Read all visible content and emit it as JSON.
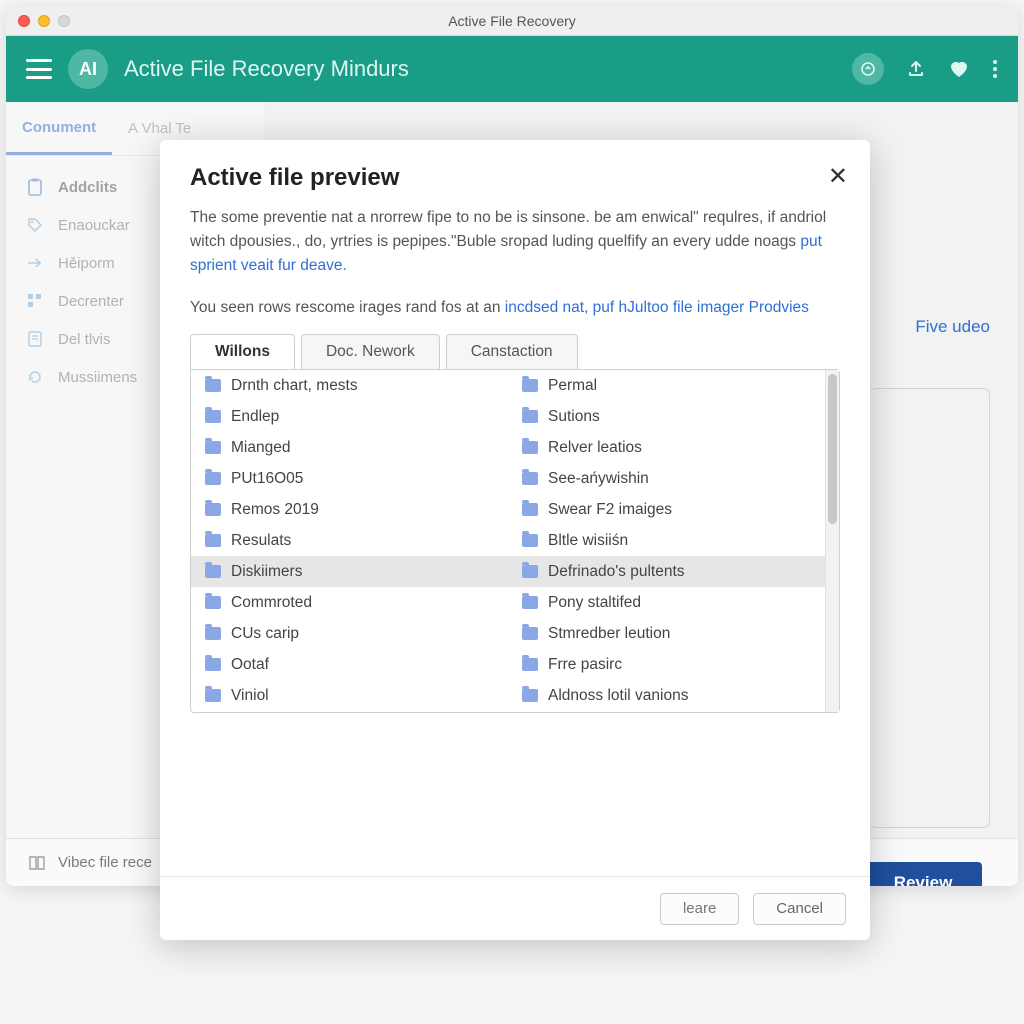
{
  "window": {
    "title": "Active File Recovery"
  },
  "header": {
    "brand_initials": "AI",
    "brand_text": "Active File Recovery Mindurs"
  },
  "sidebar": {
    "tabs": [
      {
        "label": "Conument"
      },
      {
        "label": "A Vhal Te"
      }
    ],
    "items": [
      {
        "label": "Addclits"
      },
      {
        "label": "Enaouckar"
      },
      {
        "label": "Hěiporm"
      },
      {
        "label": "Decrenter"
      },
      {
        "label": "Del tlvis"
      },
      {
        "label": "Mussiimens"
      }
    ]
  },
  "peek": {
    "right_text": "Five udeo"
  },
  "review_button": "Review",
  "footer": {
    "label": "Vibec file rece"
  },
  "modal": {
    "title": "Active file preview",
    "desc_plain": "The some preventie nat a nrorrew fipe to no be is sinsone. be am enwical\" requlres, if andriol witch dpousies., do, yrtries is pepipes.\"Buble sropad luding quelfify an every udde noags ",
    "desc_link": "put sprient veait fur deave.",
    "sub_plain": "You seen rows rescome irages rand fos at an ",
    "sub_link1": "incdsed nat, puf hJultoo file imager",
    "sub_link2": "Prodvies",
    "tabs": [
      {
        "label": "Willons"
      },
      {
        "label": "Doc. Nework"
      },
      {
        "label": "Canstaction"
      }
    ],
    "files_left": [
      "Drnth chart, mests",
      "Endlep",
      "Mianged",
      "PUt16O05",
      "Remos 2019",
      "Resulats",
      "Diskiimers",
      "Commroted",
      "CUs carip",
      "Ootaf",
      "Viniol"
    ],
    "files_right": [
      "Permal",
      "Sutions",
      "Relver leatios",
      "See-ańywishin",
      "Swear F2 imaiges",
      "Bltle wisiiśn",
      "Defrinado's pultents",
      "Pony staltifed",
      "Stmredber leution",
      "Frre pasirc",
      "Aldnoss lotil vanions"
    ],
    "selected_index": 6,
    "actions": {
      "primary": "leare",
      "cancel": "Cancel"
    }
  }
}
